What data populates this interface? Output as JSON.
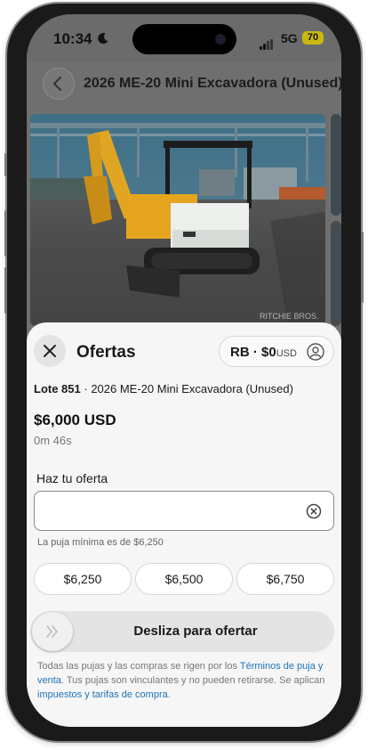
{
  "status_bar": {
    "time": "10:34",
    "network": "5G",
    "battery": "70",
    "moon_icon": "moon-icon"
  },
  "background_page": {
    "title": "2026 ME-20 Mini Excavadora (Unused)",
    "back_icon": "chevron-left-icon",
    "watermark": "RITCHIE BROS."
  },
  "sheet": {
    "title": "Ofertas",
    "close_icon": "close-icon",
    "account": {
      "initials_balance": "RB · $0",
      "currency": "USD",
      "icon": "user-icon"
    },
    "lot_number": "Lote 851",
    "lot_separator": " · ",
    "lot_title": "2026 ME-20 Mini Excavadora (Unused)",
    "current_price": "$6,000 USD",
    "time_left": "0m 46s",
    "offer_label": "Haz tu oferta",
    "offer_value": "",
    "clear_icon": "clear-circle-icon",
    "min_bid_text": "La puja mínima es de $6,250",
    "quick_bids": [
      "$6,250",
      "$6,500",
      "$6,750"
    ],
    "slider_label": "Desliza para ofertar",
    "slider_icon": "double-chevron-right-icon",
    "terms": {
      "part1": "Todas las pujas y las compras se rigen por los ",
      "link1": "Términos de puja y venta",
      "part2": ". Tus pujas son vinculantes y no pueden retirarse. Se aplican ",
      "link2": "impuestos y tarifas de compra",
      "part3": "."
    }
  },
  "colors": {
    "link": "#1e73b8",
    "battery": "#c9b80f",
    "sheet_bg": "#f6f6f6"
  }
}
